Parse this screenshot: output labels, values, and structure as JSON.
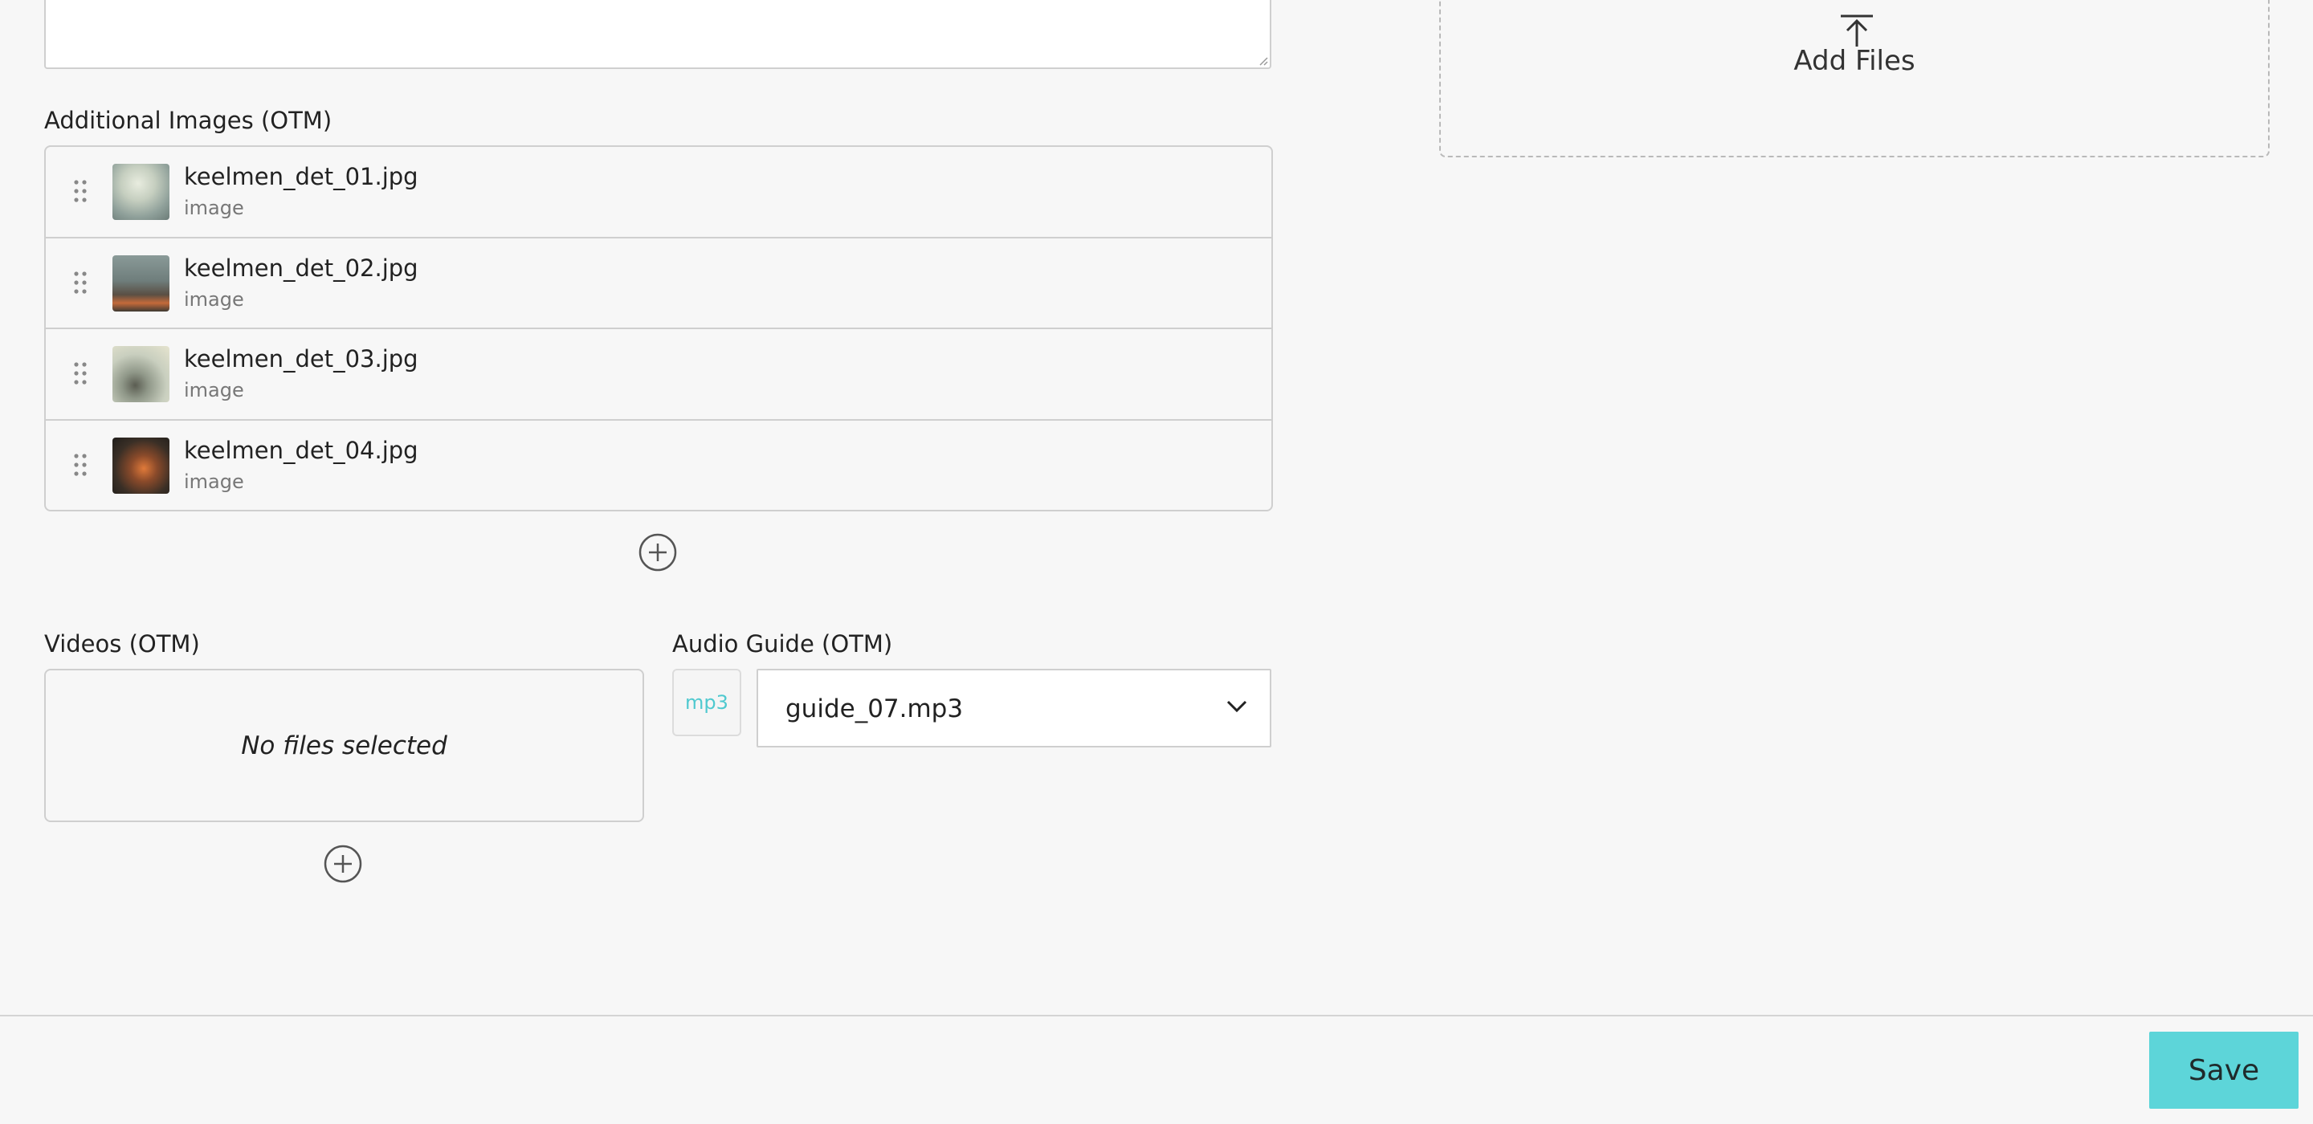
{
  "upload": {
    "label": "Add Files",
    "icon": "upload-icon"
  },
  "additional_images": {
    "label": "Additional Images (OTM)",
    "items": [
      {
        "name": "keelmen_det_01.jpg",
        "type": "image"
      },
      {
        "name": "keelmen_det_02.jpg",
        "type": "image"
      },
      {
        "name": "keelmen_det_03.jpg",
        "type": "image"
      },
      {
        "name": "keelmen_det_04.jpg",
        "type": "image"
      }
    ]
  },
  "videos": {
    "label": "Videos (OTM)",
    "empty_text": "No files selected"
  },
  "audio_guide": {
    "label": "Audio Guide (OTM)",
    "badge": "mp3",
    "selected": "guide_07.mp3"
  },
  "footer": {
    "save_label": "Save"
  },
  "colors": {
    "accent": "#5dd5d9",
    "badge_text": "#4fc9cf",
    "border": "#cfcfcf",
    "background": "#f7f7f7"
  }
}
